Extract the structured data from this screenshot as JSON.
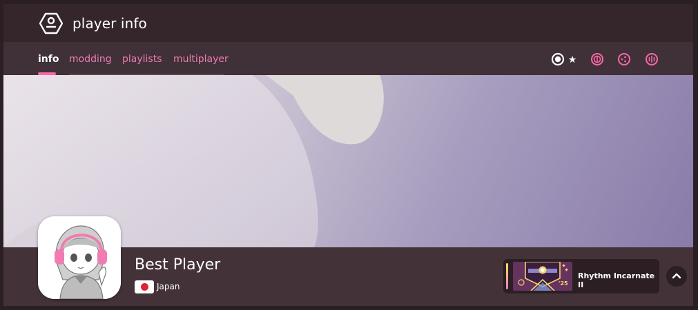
{
  "header": {
    "title": "player info",
    "logo_icon": "player-info-icon"
  },
  "tabs": [
    {
      "label": "info",
      "active": true
    },
    {
      "label": "modding",
      "active": false
    },
    {
      "label": "playlists",
      "active": false
    },
    {
      "label": "multiplayer",
      "active": false
    }
  ],
  "modes": {
    "icons": [
      "osu-mode-icon",
      "star-icon",
      "taiko-mode-icon",
      "catch-mode-icon",
      "mania-mode-icon"
    ],
    "accent": "#ff66aa"
  },
  "profile": {
    "username": "Best Player",
    "country": "Japan",
    "flag_icon": "japan-flag-icon"
  },
  "badge": {
    "label": "Rhythm Incarnate II",
    "year_text": "'25"
  },
  "colors": {
    "accent": "#ff66aa",
    "header_bg": "#34262b",
    "info_bar_bg": "#433338"
  }
}
